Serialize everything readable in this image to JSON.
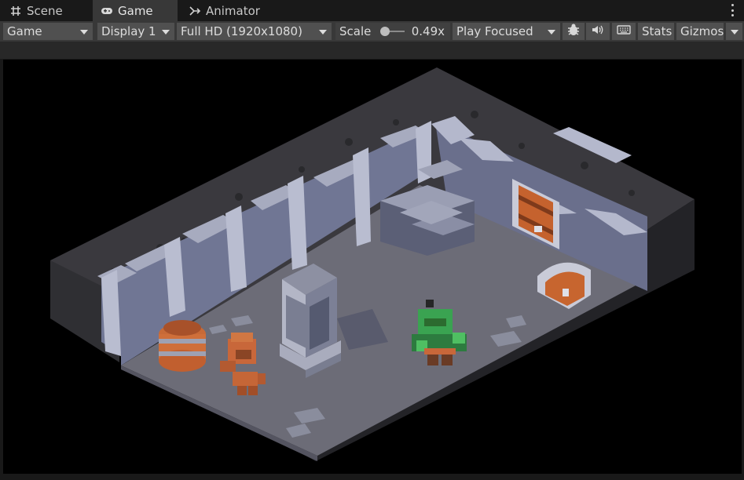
{
  "tabs": [
    {
      "label": "Scene",
      "icon": "grid-icon"
    },
    {
      "label": "Game",
      "icon": "gamepad-icon"
    },
    {
      "label": "Animator",
      "icon": "animator-icon"
    }
  ],
  "toolbar": {
    "view_select": "Game",
    "display_select": "Display 1",
    "resolution_select": "Full HD (1920x1080)",
    "scale_label": "Scale",
    "scale_value": "0.49x",
    "scale_fraction": 0.49,
    "play_mode_select": "Play Focused",
    "stats_label": "Stats",
    "gizmos_label": "Gizmos"
  },
  "colors": {
    "accent_orange": "#d9773f",
    "character_green": "#3aa351",
    "floor": "#6d6d78",
    "walls": "#9fa3b8",
    "void": "#000000"
  }
}
